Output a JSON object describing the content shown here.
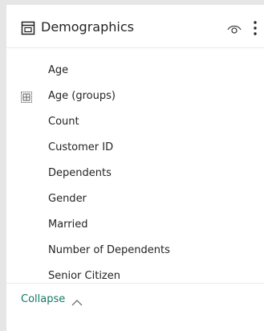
{
  "table": {
    "title": "Demographics",
    "icon": "table-icon"
  },
  "header_icons": {
    "visibility": "eye-icon",
    "more": "more-options-icon"
  },
  "fields": [
    {
      "label": "Age",
      "icon": null
    },
    {
      "label": "Age (groups)",
      "icon": "hierarchy-icon"
    },
    {
      "label": "Count",
      "icon": null
    },
    {
      "label": "Customer ID",
      "icon": null
    },
    {
      "label": "Dependents",
      "icon": null
    },
    {
      "label": "Gender",
      "icon": null
    },
    {
      "label": "Married",
      "icon": null
    },
    {
      "label": "Number of Dependents",
      "icon": null
    },
    {
      "label": "Senior Citizen",
      "icon": null
    }
  ],
  "footer": {
    "collapse_label": "Collapse",
    "collapse_icon": "chevron-up-icon"
  },
  "colors": {
    "background": "#e6e6e6",
    "panel": "#ffffff",
    "text": "#252423",
    "accent": "#117865"
  }
}
